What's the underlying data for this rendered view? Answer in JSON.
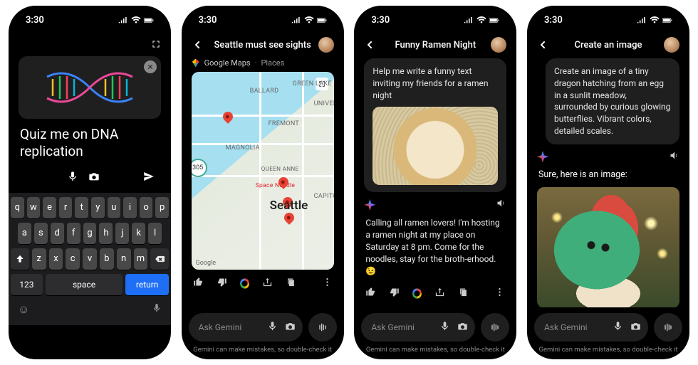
{
  "status": {
    "time": "3:30"
  },
  "phone1": {
    "prompt": "Quiz me on DNA replication",
    "keyboard": {
      "row1": [
        "q",
        "w",
        "e",
        "r",
        "t",
        "y",
        "u",
        "i",
        "o",
        "p"
      ],
      "row2": [
        "a",
        "s",
        "d",
        "f",
        "g",
        "h",
        "j",
        "k",
        "l"
      ],
      "row3": [
        "z",
        "x",
        "c",
        "v",
        "b",
        "n",
        "m"
      ],
      "numKey": "123",
      "spaceKey": "space",
      "returnKey": "return"
    }
  },
  "phone2": {
    "title": "Seattle must see sights",
    "source": {
      "app": "Google Maps",
      "kind": "Places"
    },
    "map": {
      "city": "Seattle",
      "poi": "Space Needle",
      "hoods": [
        "BALLARD",
        "FREMONT",
        "MAGNOLIA",
        "QUEEN ANNE",
        "CAPITOL",
        "GREEN LAKE",
        "UNIVERSI"
      ],
      "route": "305",
      "logo": "Google"
    },
    "askPlaceholder": "Ask Gemini",
    "disclaimer": "Gemini can make mistakes, so double-check it"
  },
  "phone3": {
    "title": "Funny Ramen Night",
    "userMsg": "Help me write a funny text inviting my friends for a ramen night",
    "reply": "Calling all ramen lovers! I'm hosting a ramen night at my place on Saturday at 8 pm.  Come for the noodles, stay for the broth-erhood. 😉",
    "askPlaceholder": "Ask Gemini",
    "disclaimer": "Gemini can make mistakes, so double-check it"
  },
  "phone4": {
    "title": "Create an image",
    "userMsg": "Create an image of a tiny dragon hatching from an egg in a sunlit meadow, surrounded by curious glowing butterflies. Vibrant colors, detailed scales.",
    "reply": "Sure, here is an image:",
    "askPlaceholder": "Ask Gemini",
    "disclaimer": "Gemini can make mistakes, so double-check it"
  }
}
